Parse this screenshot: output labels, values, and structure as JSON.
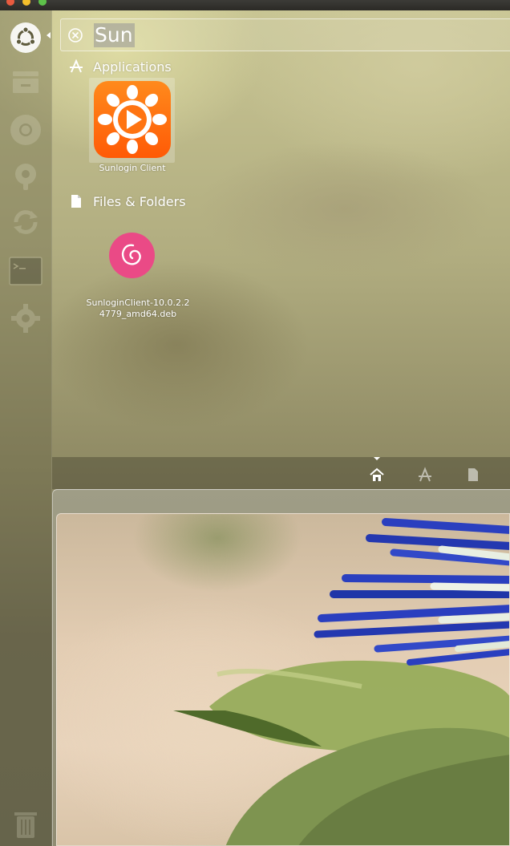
{
  "search": {
    "query": "Sun"
  },
  "categories": {
    "applications": {
      "label": "Applications"
    },
    "files": {
      "label": "Files & Folders"
    }
  },
  "results": {
    "app": {
      "label": "Sunlogin Client"
    },
    "file": {
      "label_line1": "SunloginClient-10.0.2.2",
      "label_line2": "4779_amd64.deb"
    }
  },
  "icons": {
    "dash": "ubuntu-logo-icon",
    "clear": "clear-circle-icon",
    "applications": "applications-icon",
    "files": "file-icon",
    "lens_home": "home-icon",
    "lens_apps": "applications-icon",
    "lens_files": "file-icon"
  },
  "colors": {
    "app_tile": "#ff6a10",
    "deb_icon": "#ea4a86",
    "launcher_bg": "#5f5c3e",
    "window_close": "#e95b3f",
    "window_minimize": "#f5bf2b",
    "window_maximize": "#5ec24a"
  }
}
